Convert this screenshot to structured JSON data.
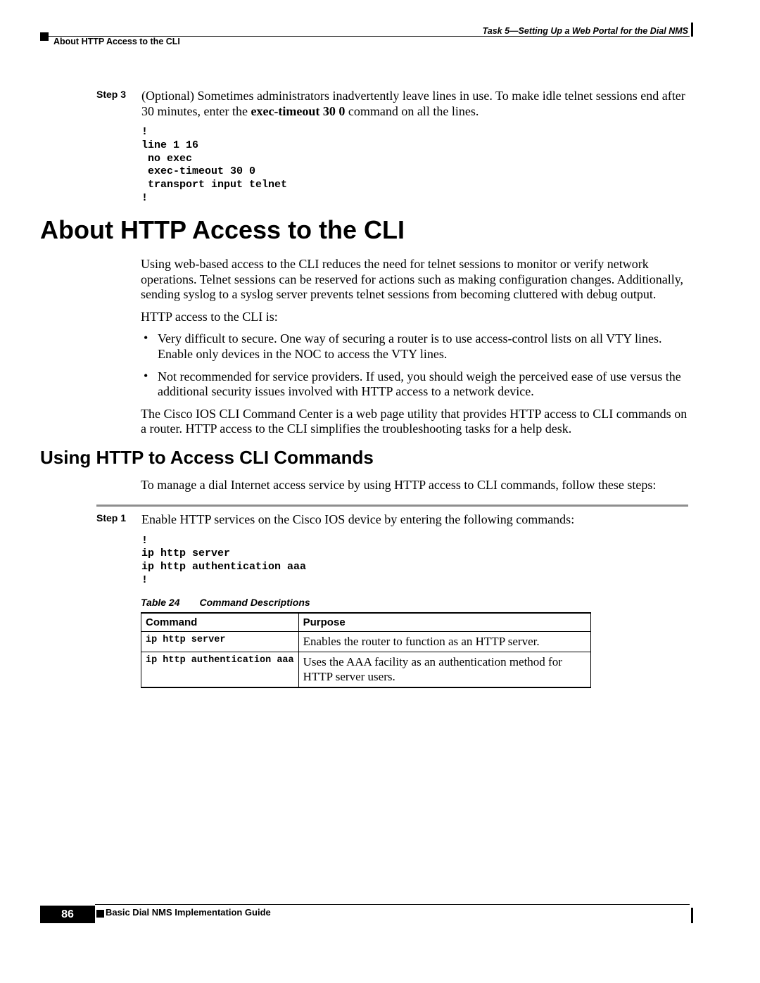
{
  "header": {
    "right": "Task 5—Setting Up a Web Portal for the Dial NMS",
    "left": "About HTTP Access to the CLI"
  },
  "step3": {
    "label": "Step 3",
    "text_before_bold": "(Optional) Sometimes administrators inadvertently leave lines in use. To make idle telnet sessions end after 30 minutes, enter the ",
    "bold": "exec-timeout 30 0",
    "text_after_bold": " command on all the lines.",
    "code": "!\nline 1 16\n no exec\n exec-timeout 30 0\n transport input telnet\n!"
  },
  "h1": "About HTTP Access to the CLI",
  "body1": {
    "p1": "Using web-based access to the CLI reduces the need for telnet sessions to monitor or verify network operations. Telnet sessions can be reserved for actions such as making configuration changes. Additionally, sending syslog to a syslog server prevents telnet sessions from becoming cluttered with debug output.",
    "p2": "HTTP access to the CLI is:",
    "bullets": [
      "Very difficult to secure. One way of securing a router is to use access-control lists on all VTY lines. Enable only devices in the NOC to access the VTY lines.",
      "Not recommended for service providers. If used, you should weigh the perceived ease of use versus the additional security issues involved with HTTP access to a network device."
    ],
    "p3": "The Cisco IOS CLI Command Center is a web page utility that provides HTTP access to CLI commands on a router. HTTP access to the CLI simplifies the troubleshooting tasks for a help desk."
  },
  "h2": "Using HTTP to Access CLI Commands",
  "body2": {
    "p1": "To manage a dial Internet access service by using HTTP access to CLI commands, follow these steps:"
  },
  "step1": {
    "label": "Step 1",
    "text": "Enable HTTP services on the Cisco IOS device by entering the following commands:",
    "code": "!\nip http server\nip http authentication aaa\n!"
  },
  "table": {
    "caption_num": "Table 24",
    "caption_title": "Command Descriptions",
    "headers": {
      "c1": "Command",
      "c2": "Purpose"
    },
    "rows": [
      {
        "cmd": "ip http server",
        "purpose": "Enables the router to function as an HTTP server."
      },
      {
        "cmd": "ip http authentication aaa",
        "purpose": "Uses the AAA facility as an authentication method for HTTP server users."
      }
    ]
  },
  "footer": {
    "title": "Basic Dial NMS Implementation Guide",
    "page": "86"
  }
}
